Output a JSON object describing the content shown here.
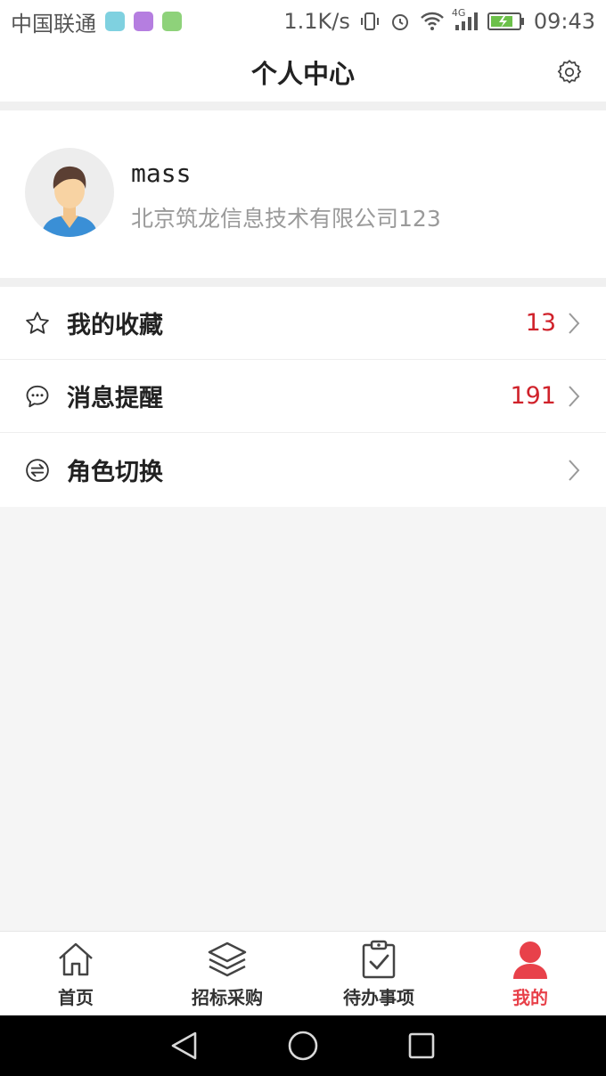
{
  "status_bar": {
    "carrier": "中国联通",
    "speed": "1.1K/s",
    "network": "4G",
    "time": "09:43"
  },
  "header": {
    "title": "个人中心",
    "settings_icon": "gear-icon"
  },
  "profile": {
    "username": "mass",
    "company": "北京筑龙信息技术有限公司123",
    "avatar_icon": "avatar-icon"
  },
  "menu": {
    "items": [
      {
        "label": "我的收藏",
        "count": "13",
        "icon": "star-icon"
      },
      {
        "label": "消息提醒",
        "count": "191",
        "icon": "chat-bubble-icon"
      },
      {
        "label": "角色切换",
        "count": "",
        "icon": "switch-icon"
      }
    ]
  },
  "tabbar": {
    "tabs": [
      {
        "label": "首页",
        "icon": "home-icon"
      },
      {
        "label": "招标采购",
        "icon": "layers-icon"
      },
      {
        "label": "待办事项",
        "icon": "clipboard-check-icon"
      },
      {
        "label": "我的",
        "icon": "person-icon",
        "active": true
      }
    ]
  },
  "colors": {
    "accent": "#e8414a",
    "count": "#d0222b",
    "background": "#f5f5f5"
  }
}
